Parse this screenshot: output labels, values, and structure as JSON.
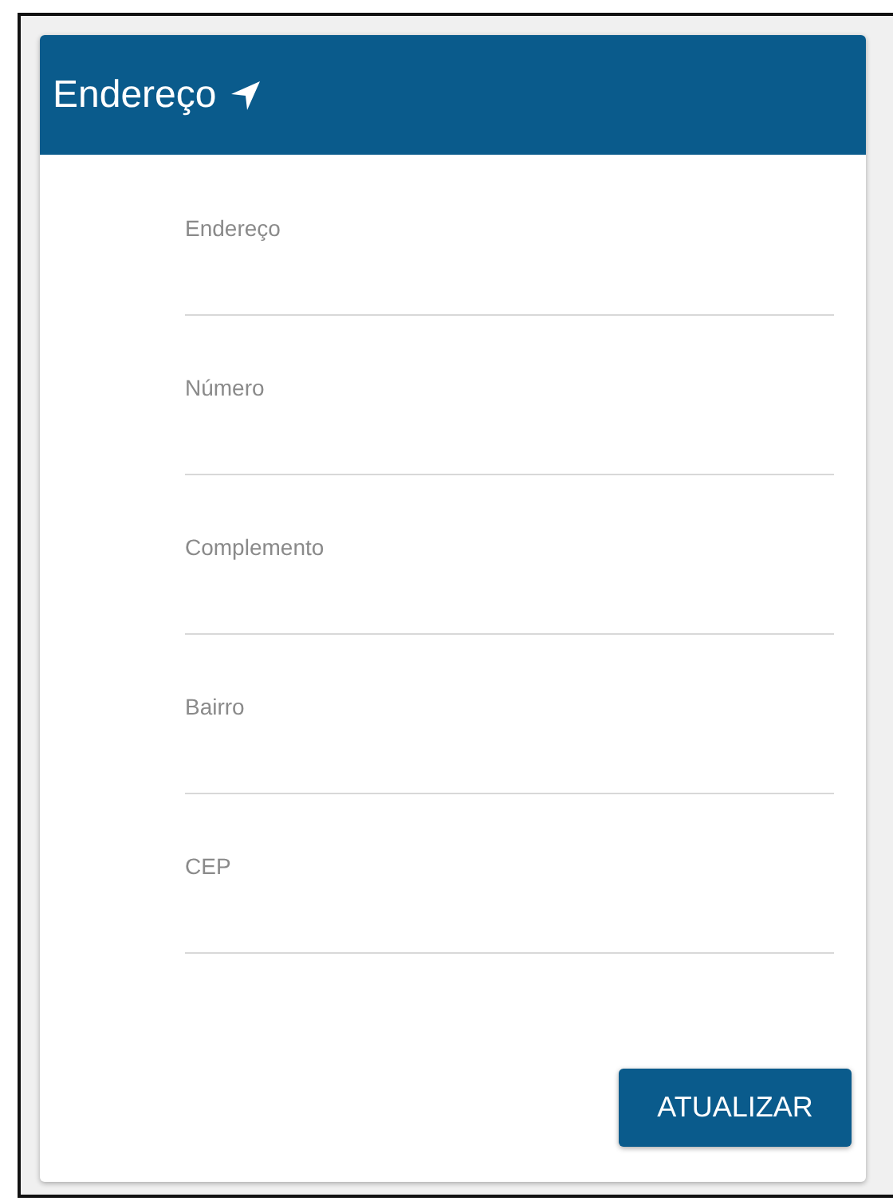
{
  "card": {
    "title": "Endereço"
  },
  "fields": [
    {
      "label": "Endereço"
    },
    {
      "label": "Número"
    },
    {
      "label": "Complemento"
    },
    {
      "label": "Bairro"
    },
    {
      "label": "CEP"
    }
  ],
  "buttons": [
    "ATUALIZAR"
  ]
}
